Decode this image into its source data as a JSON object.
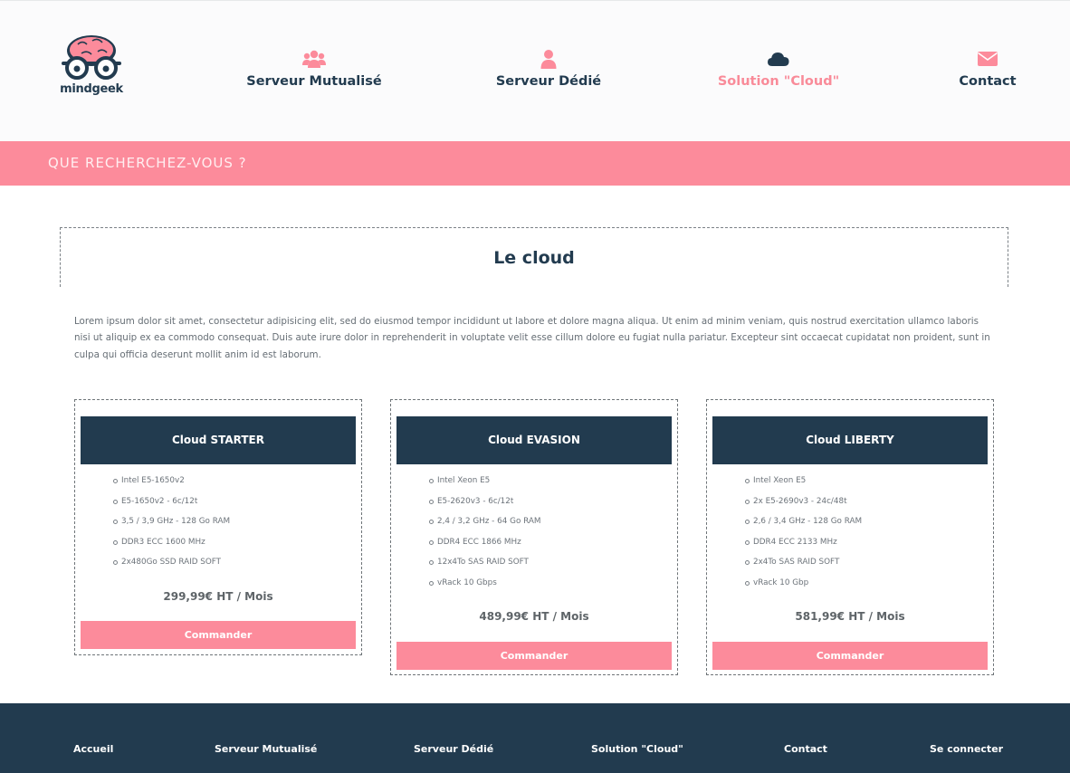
{
  "colors": {
    "navy": "#223b4f",
    "pink": "#fc8b9b",
    "header_bg": "#fbfbfc"
  },
  "logo": {
    "text": "mindgeek"
  },
  "nav": [
    {
      "label": "Serveur Mutualisé",
      "icon": "users-icon",
      "active": false
    },
    {
      "label": "Serveur Dédié",
      "icon": "user-icon",
      "active": false
    },
    {
      "label": "Solution \"Cloud\"",
      "icon": "cloud-icon",
      "active": true
    },
    {
      "label": "Contact",
      "icon": "envelope-icon",
      "active": false
    }
  ],
  "search": {
    "placeholder": "QUE RECHERCHEZ-VOUS ?"
  },
  "page": {
    "title": "Le cloud",
    "intro": "Lorem ipsum dolor sit amet, consectetur adipisicing elit, sed do eiusmod tempor incididunt ut labore et dolore magna aliqua. Ut enim ad minim veniam, quis nostrud exercitation ullamco laboris nisi ut aliquip ex ea commodo consequat. Duis aute irure dolor in reprehenderit in voluptate velit esse cillum dolore eu fugiat nulla pariatur. Excepteur sint occaecat cupidatat non proident, sunt in culpa qui officia deserunt mollit anim id est laborum."
  },
  "offers": [
    {
      "name": "Cloud STARTER",
      "specs": [
        "Intel E5-1650v2",
        "E5-1650v2 - 6c/12t",
        "3,5 / 3,9 GHz - 128 Go RAM",
        "DDR3 ECC 1600 MHz",
        "2x480Go SSD RAID SOFT"
      ],
      "price": "299,99€ HT / Mois",
      "button": "Commander"
    },
    {
      "name": "Cloud EVASION",
      "specs": [
        "Intel Xeon E5",
        "E5-2620v3 - 6c/12t",
        "2,4 / 3,2 GHz - 64 Go RAM",
        "DDR4 ECC 1866 MHz",
        "12x4To SAS RAID SOFT",
        "vRack 10 Gbps"
      ],
      "price": "489,99€ HT / Mois",
      "button": "Commander"
    },
    {
      "name": "Cloud LIBERTY",
      "specs": [
        "Intel Xeon E5",
        "2x E5-2690v3 - 24c/48t",
        "2,6 / 3,4 GHz - 128 Go RAM",
        "DDR4 ECC 2133 MHz",
        "2x4To SAS RAID SOFT",
        "vRack 10 Gbp"
      ],
      "price": "581,99€ HT / Mois",
      "button": "Commander"
    }
  ],
  "footer": {
    "links": [
      "Accueil",
      "Serveur Mutualisé",
      "Serveur Dédié",
      "Solution \"Cloud\"",
      "Contact",
      "Se connecter"
    ]
  }
}
